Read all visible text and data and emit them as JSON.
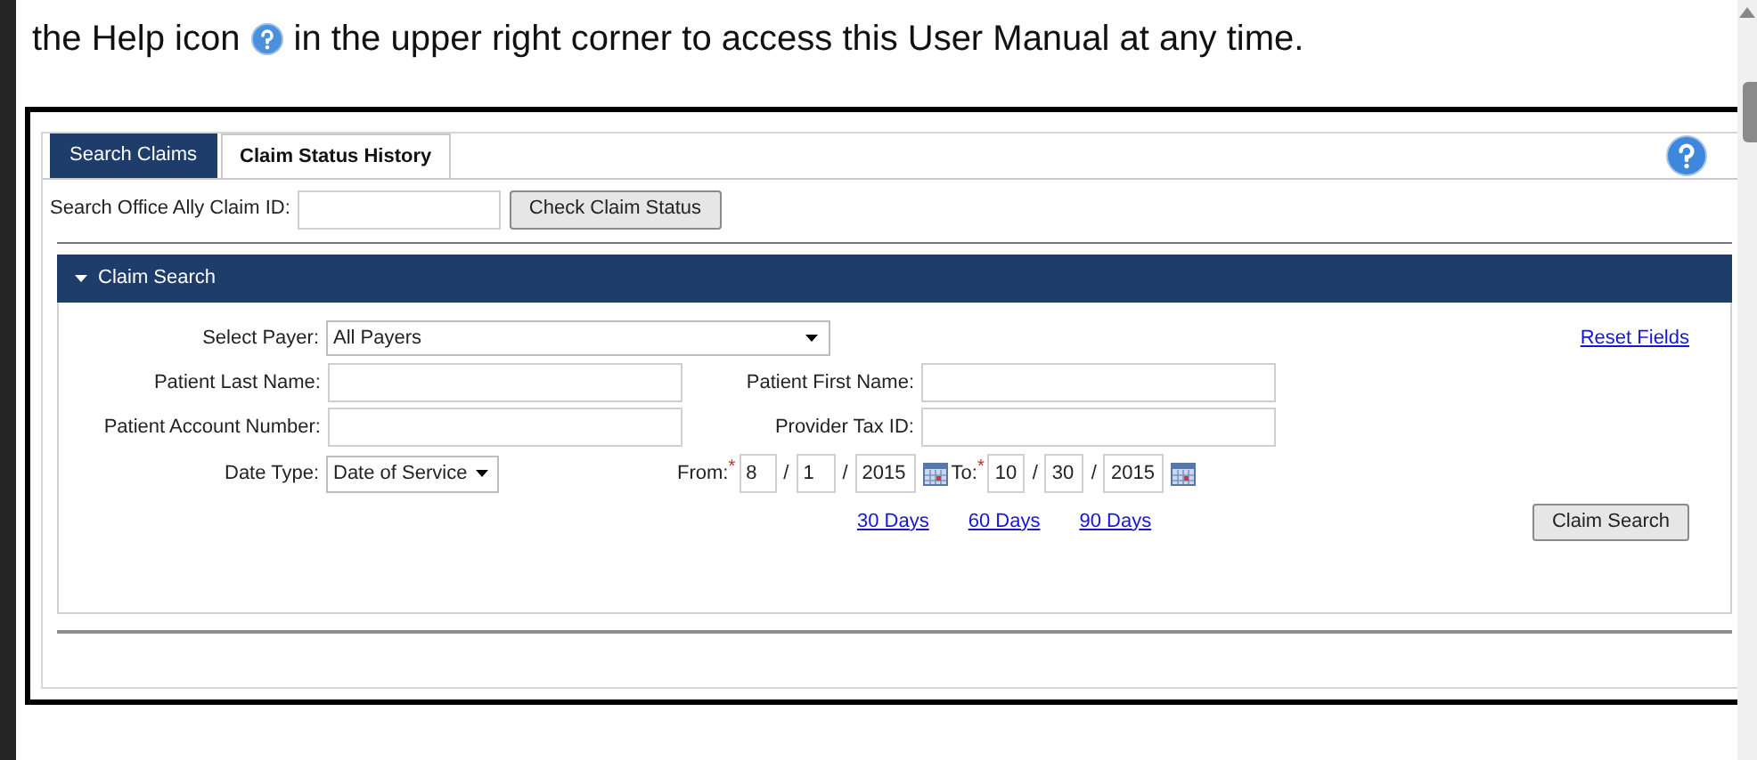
{
  "intro": {
    "before": "the Help icon",
    "after": "in the upper right corner to access this User Manual at any time."
  },
  "tabs": [
    {
      "label": "Search Claims",
      "selected": false
    },
    {
      "label": "Claim Status History",
      "selected": true
    }
  ],
  "claim_id": {
    "label": "Search Office Ally Claim ID:",
    "button": "Check Claim Status"
  },
  "section": {
    "title": "Claim Search",
    "expanded": true
  },
  "payer": {
    "label": "Select Payer:",
    "value": "All Payers"
  },
  "reset": "Reset Fields",
  "fields": [
    {
      "label": "Patient Last Name:"
    },
    {
      "label": "Patient First Name:"
    },
    {
      "label": "Patient Account Number:"
    },
    {
      "label": "Provider Tax ID:"
    }
  ],
  "date_type": {
    "label": "Date Type:",
    "value": "Date of Service"
  },
  "dates": [
    {
      "label": "From:",
      "marker": "*",
      "parts": [
        "8",
        "1",
        "2015"
      ],
      "separators": [
        "/",
        "/"
      ]
    },
    {
      "label": "To:",
      "marker": "*",
      "parts": [
        "10",
        "30",
        "2015"
      ],
      "separators": [
        "/",
        "/"
      ]
    }
  ],
  "ranges": [
    "30 Days",
    "60 Days",
    "90 Days"
  ],
  "search_button": "Claim Search"
}
